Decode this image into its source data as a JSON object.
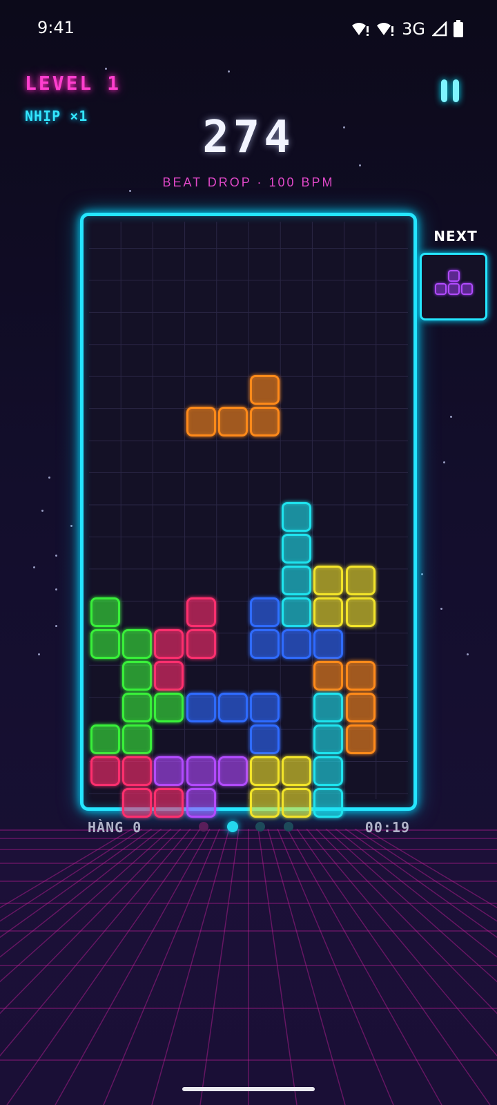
{
  "status_bar": {
    "time": "9:41",
    "network": "3G",
    "icons": [
      "wifi-alert-icon",
      "wifi-alert-icon",
      "signal-icon",
      "battery-icon"
    ]
  },
  "hud": {
    "level_label": "LEVEL 1",
    "combo_label": "NHỊP ×1",
    "score": "274",
    "song_info": "BEAT DROP · 100 BPM",
    "lines_label": "HÀNG 0",
    "timer": "00:19",
    "pause_icon": "pause-icon"
  },
  "next_piece": {
    "label": "NEXT",
    "shape": "T",
    "color": "#b24bff"
  },
  "board": {
    "columns": 10,
    "rows": 18,
    "colors": {
      "G": "#39f03a",
      "R": "#ff2f6e",
      "B": "#2f6bff",
      "C": "#1fe3ee",
      "Y": "#f2e42a",
      "O": "#ff8a1a",
      "P": "#b24bff"
    },
    "grid": [
      "..........",
      "..........",
      "..........",
      "..........",
      "..........",
      ".....O....",
      "...OOO....",
      "..........",
      "..........",
      "......C...",
      "......C...",
      "......CYY.",
      "G..R.BCYY.",
      "GGRR.BBB..",
      ".GR....OO.",
      ".GGBBB.CO.",
      "GG...B.CO.",
      "RRPPPYYC..",
      ".RRP.YYC.."
    ]
  },
  "progress_dots": {
    "count": 4,
    "active_index": 1
  },
  "theme": {
    "board_glow": "#25e6ff",
    "level_color": "#ff3fcf",
    "combo_color": "#34e7ff",
    "floor_grid": "#c21f9a"
  }
}
